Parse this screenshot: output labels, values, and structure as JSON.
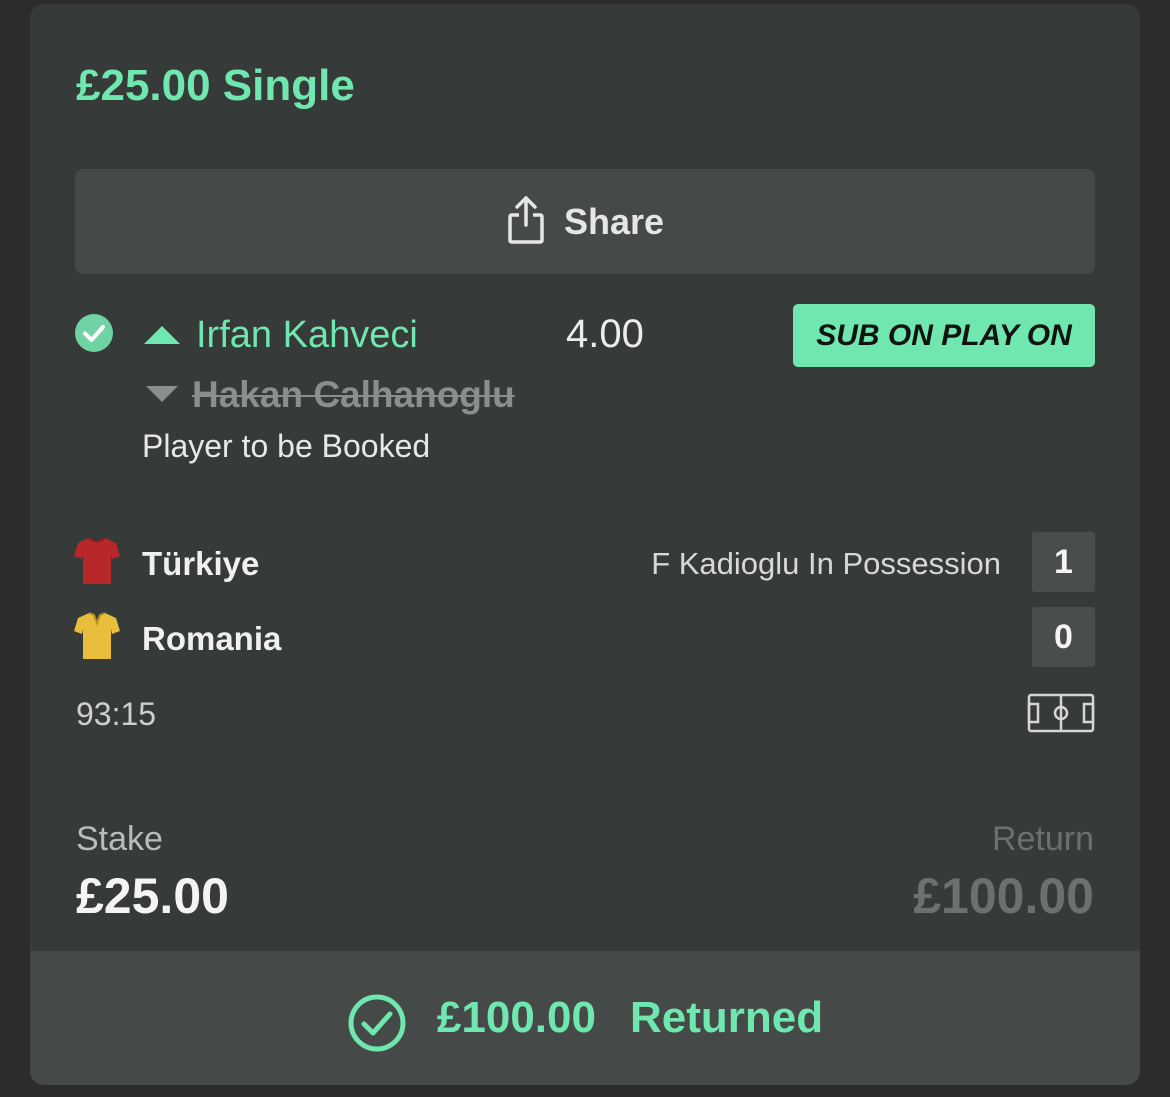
{
  "bet": {
    "title": "£25.00 Single"
  },
  "share": {
    "label": "Share",
    "icon": "share-icon"
  },
  "selection": {
    "status_icon": "check-circle-icon",
    "player_in": "Irfan Kahveci",
    "player_out": "Hakan Calhanoglu",
    "odds": "4.00",
    "badge": "SUB ON PLAY ON",
    "market": "Player to be Booked"
  },
  "match": {
    "teams": [
      {
        "name": "Türkiye",
        "score": "1",
        "shirt_color": "#b8282a"
      },
      {
        "name": "Romania",
        "score": "0",
        "shirt_color": "#e8be3c"
      }
    ],
    "status": "F Kadioglu In Possession",
    "clock": "93:15",
    "pitch_icon": "pitch-icon"
  },
  "stake": {
    "label": "Stake",
    "value": "£25.00"
  },
  "return": {
    "label": "Return",
    "value": "£100.00"
  },
  "footer": {
    "amount": "£100.00",
    "label": "Returned"
  },
  "colors": {
    "accent": "#6fe7ae",
    "card_bg": "#363a38",
    "panel_bg": "#454a48"
  }
}
